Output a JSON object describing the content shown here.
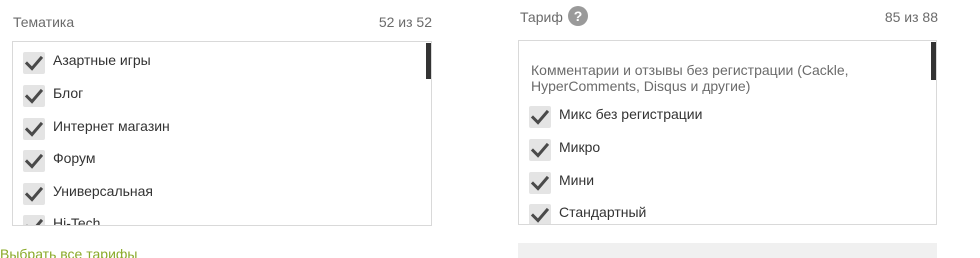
{
  "themes": {
    "title": "Тематика",
    "count": "52 из 52",
    "items": [
      {
        "label": "Азартные игры",
        "checked": true
      },
      {
        "label": "Блог",
        "checked": true
      },
      {
        "label": "Интернет магазин",
        "checked": true
      },
      {
        "label": "Форум",
        "checked": true
      },
      {
        "label": "Универсальная",
        "checked": true
      },
      {
        "label": "Hi-Tech",
        "checked": true
      }
    ]
  },
  "tariff": {
    "title": "Тариф",
    "help_icon": "question-icon",
    "help_glyph": "?",
    "count": "85 из 88",
    "group_heading": "Комментарии и отзывы без регистрации (Cackle, HyperComments, Disqus и другие)",
    "items": [
      {
        "label": "Микс без регистрации",
        "checked": true
      },
      {
        "label": "Микро",
        "checked": true
      },
      {
        "label": "Мини",
        "checked": true
      },
      {
        "label": "Стандартный",
        "checked": true
      }
    ]
  },
  "footer": {
    "select_all_link": "Выбрать все тарифы"
  },
  "colors": {
    "link": "#8aaa2a",
    "checkbox_bg": "#e4e4e4",
    "check_mark": "#4a4a4a",
    "scroll_thumb": "#333333"
  }
}
